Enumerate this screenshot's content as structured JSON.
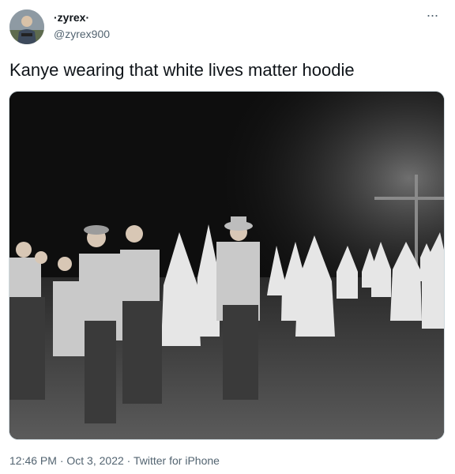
{
  "author": {
    "display_name": "·zyrex·",
    "handle": "@zyrex900",
    "avatar_icon": "avatar-image"
  },
  "menu": {
    "icon": "more-horizontal-icon",
    "label": "···"
  },
  "tweet": {
    "text": "Kanye wearing that white lives matter hoodie",
    "media_icon": "photo-image"
  },
  "meta": {
    "time": "12:46 PM",
    "sep1": " · ",
    "date": "Oct 3, 2022",
    "sep2": " · ",
    "source": "Twitter for iPhone"
  },
  "colors": {
    "text": "#0f1419",
    "secondary": "#536471",
    "border": "#cfd9de"
  }
}
